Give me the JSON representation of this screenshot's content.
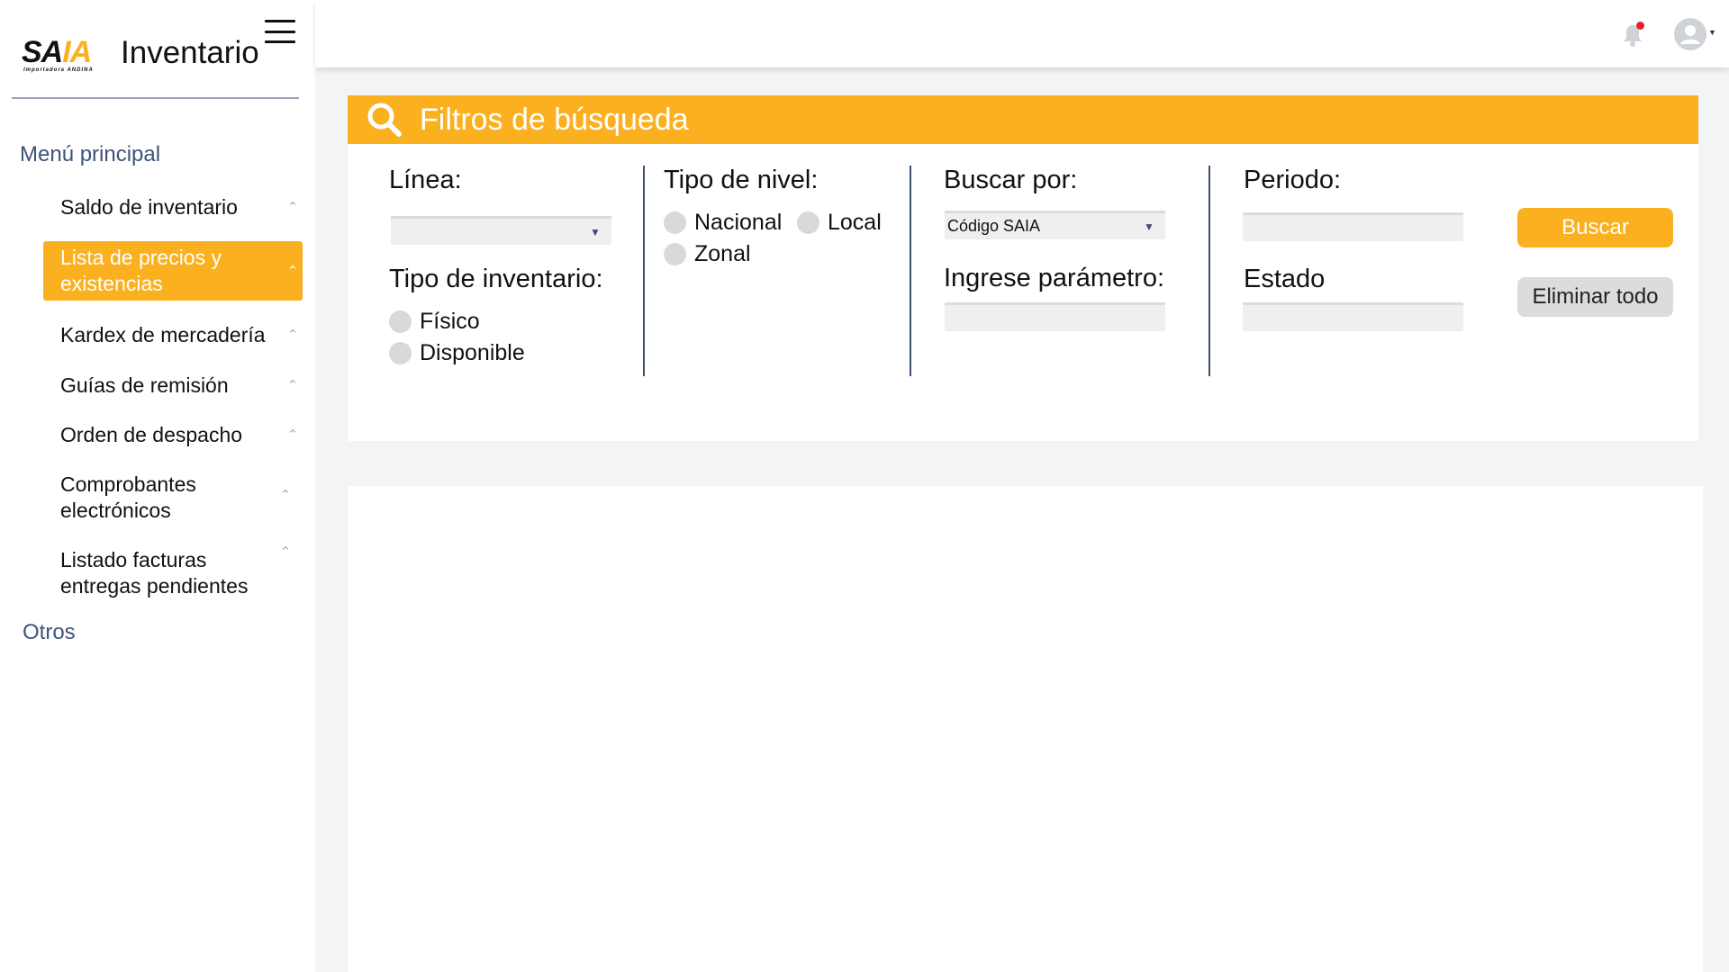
{
  "app": {
    "logo_text": "SAIA",
    "logo_sub": "Importadora ANDINA",
    "title": "Inventario"
  },
  "sidebar": {
    "main_section": "Menú principal",
    "items": [
      {
        "label": "Saldo de inventario"
      },
      {
        "label": "Lista de precios y existencias"
      },
      {
        "label": "Kardex de mercadería"
      },
      {
        "label": "Guías de remisión"
      },
      {
        "label": "Orden de despacho"
      },
      {
        "label": "Comprobantes electrónicos"
      },
      {
        "label": "Listado facturas entregas pendientes"
      }
    ],
    "active_item": "Lista de precios y existencias",
    "other_section": "Otros"
  },
  "filters": {
    "header_title": "Filtros de búsqueda",
    "linea": {
      "label": "Línea:",
      "value": ""
    },
    "tipo_inventario": {
      "label": "Tipo de inventario:",
      "options": [
        "Físico",
        "Disponible"
      ]
    },
    "tipo_nivel": {
      "label": "Tipo de nivel:",
      "options": [
        "Nacional",
        "Local",
        "Zonal"
      ]
    },
    "buscar_por": {
      "label": "Buscar por:",
      "value": "Código SAIA"
    },
    "parametro": {
      "label": "Ingrese parámetro:",
      "value": ""
    },
    "periodo": {
      "label": "Periodo:",
      "value": ""
    },
    "estado": {
      "label": "Estado",
      "value": ""
    },
    "buttons": {
      "search": "Buscar",
      "clear": "Eliminar todo"
    }
  },
  "colors": {
    "accent": "#fbb01f",
    "nav_section": "#3d5478",
    "divider": "#3e4f72",
    "notification_dot": "#e3232b"
  }
}
